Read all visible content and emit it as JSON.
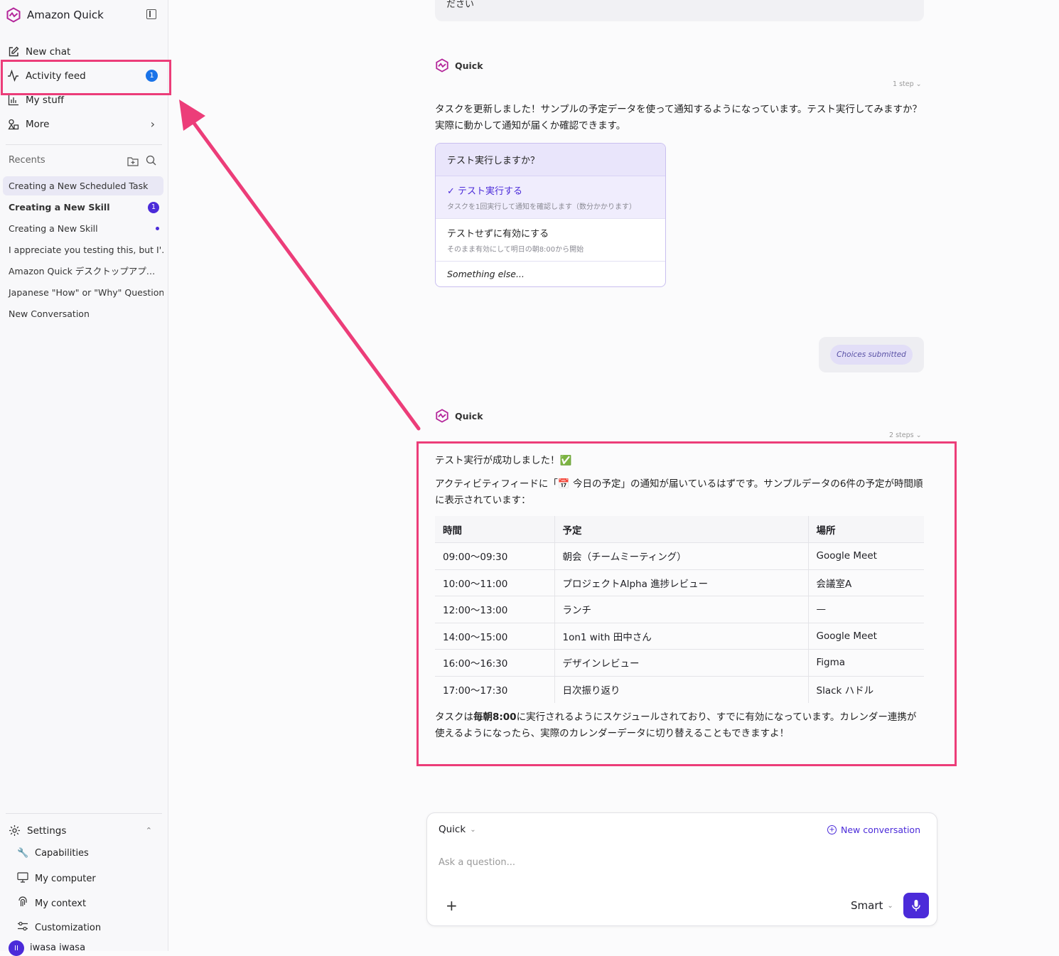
{
  "sidebar": {
    "brand": "Amazon Quick",
    "nav": {
      "new_chat": "New chat",
      "activity_feed": "Activity feed",
      "activity_badge": "1",
      "my_stuff": "My stuff",
      "more": "More"
    },
    "recents_label": "Recents",
    "recents": [
      {
        "label": "Creating a New Scheduled Task"
      },
      {
        "label": "Creating a New Skill",
        "badge": "1"
      },
      {
        "label": "Creating a New Skill"
      },
      {
        "label": "I appreciate you testing this, but I'…"
      },
      {
        "label": "Amazon Quick デスクトップアプ…"
      },
      {
        "label": "Japanese \"How\" or \"Why\" Question"
      },
      {
        "label": "New Conversation"
      }
    ],
    "settings": {
      "label": "Settings",
      "items": [
        "Capabilities",
        "My computer",
        "My context",
        "Customization"
      ]
    },
    "user": {
      "name": "iwasa iwasa",
      "initial": "II"
    }
  },
  "chat": {
    "top_fragment": "ださい",
    "agent_name": "Quick",
    "msg1": {
      "steps": "1 step",
      "text": "タスクを更新しました！サンプルの予定データを使って通知するようになっています。テスト実行してみますか？実際に動かして通知が届くか確認できます。"
    },
    "choice_card": {
      "question": "テスト実行しますか？",
      "options": [
        {
          "title": "✓ テスト実行する",
          "sub": "タスクを1回実行して通知を確認します（数分かかります）"
        },
        {
          "title": "テストせずに有効にする",
          "sub": "そのまま有効にして明日の朝8:00から開始"
        }
      ],
      "else": "Something else..."
    },
    "choices_submitted": "Choices submitted",
    "msg2": {
      "steps": "2 steps",
      "line1": "テスト実行が成功しました！✅",
      "line2": "アクティビティフィードに「📅 今日の予定」の通知が届いているはずです。サンプルデータの6件の予定が時間順に表示されています：",
      "table": {
        "headers": [
          "時間",
          "予定",
          "場所"
        ],
        "rows": [
          [
            "09:00〜09:30",
            "朝会（チームミーティング）",
            "Google Meet"
          ],
          [
            "10:00〜11:00",
            "プロジェクトAlpha 進捗レビュー",
            "会議室A"
          ],
          [
            "12:00〜13:00",
            "ランチ",
            "—"
          ],
          [
            "14:00〜15:00",
            "1on1 with 田中さん",
            "Google Meet"
          ],
          [
            "16:00〜16:30",
            "デザインレビュー",
            "Figma"
          ],
          [
            "17:00〜17:30",
            "日次振り返り",
            "Slack ハドル"
          ]
        ]
      },
      "closing_pre": "タスクは",
      "closing_bold": "毎朝8:00",
      "closing_post": "に実行されるようにスケジュールされており、すでに有効になっています。カレンダー連携が使えるようになったら、実際のカレンダーデータに切り替えることもできますよ！"
    }
  },
  "composer": {
    "agent": "Quick",
    "new_conversation": "New conversation",
    "placeholder": "Ask a question...",
    "mode": "Smart"
  },
  "colors": {
    "highlight": "#ec3d79",
    "accent": "#4b2bd9",
    "badge_blue": "#1a73e8"
  }
}
